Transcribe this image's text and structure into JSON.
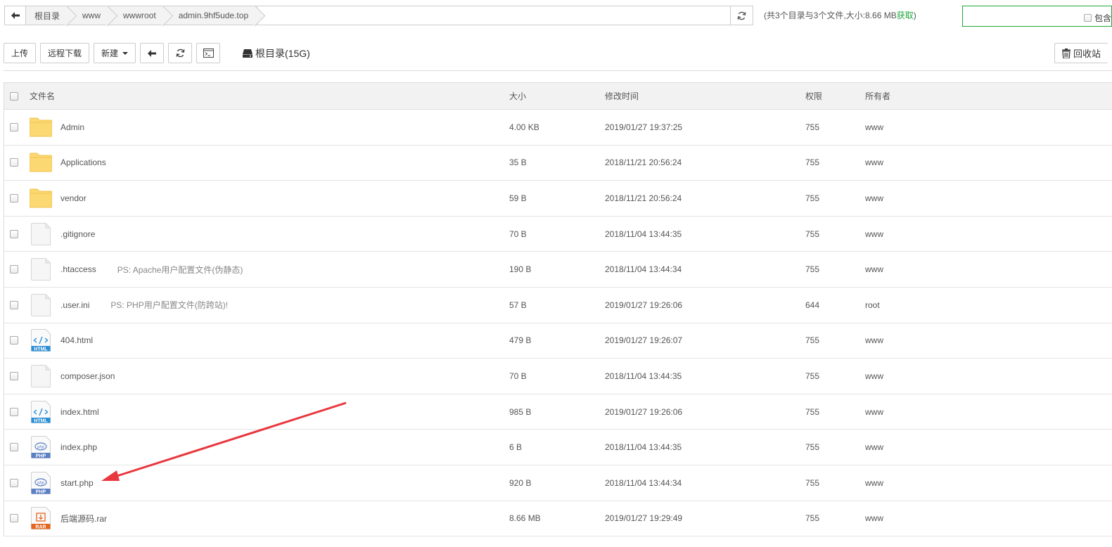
{
  "path": {
    "crumbs": [
      "根目录",
      "www",
      "wwwroot",
      "admin.9hf5ude.top"
    ]
  },
  "summary": {
    "text": "(共3个目录与3个文件,大小:8.66 MB",
    "link": "获取",
    "close": ")"
  },
  "search": {
    "include_label": "包含"
  },
  "toolbar": {
    "upload": "上传",
    "remote_download": "远程下载",
    "new": "新建",
    "disk_label": "根目录(15G)",
    "recycle": "回收站"
  },
  "table": {
    "headers": {
      "name": "文件名",
      "size": "大小",
      "time": "修改时间",
      "perm": "权限",
      "owner": "所有者"
    },
    "rows": [
      {
        "name": "Admin",
        "note": "",
        "icon": "folder-icon",
        "size": "4.00 KB",
        "time": "2019/01/27 19:37:25",
        "perm": "755",
        "owner": "www"
      },
      {
        "name": "Applications",
        "note": "",
        "icon": "folder-icon",
        "size": "35 B",
        "time": "2018/11/21 20:56:24",
        "perm": "755",
        "owner": "www"
      },
      {
        "name": "vendor",
        "note": "",
        "icon": "folder-icon",
        "size": "59 B",
        "time": "2018/11/21 20:56:24",
        "perm": "755",
        "owner": "www"
      },
      {
        "name": ".gitignore",
        "note": "",
        "icon": "file-icon",
        "size": "70 B",
        "time": "2018/11/04 13:44:35",
        "perm": "755",
        "owner": "www"
      },
      {
        "name": ".htaccess",
        "note": "PS: Apache用户配置文件(伪静态)",
        "icon": "file-icon",
        "size": "190 B",
        "time": "2018/11/04 13:44:34",
        "perm": "755",
        "owner": "www"
      },
      {
        "name": ".user.ini",
        "note": "PS: PHP用户配置文件(防跨站)!",
        "icon": "file-icon",
        "size": "57 B",
        "time": "2019/01/27 19:26:06",
        "perm": "644",
        "owner": "root"
      },
      {
        "name": "404.html",
        "note": "",
        "icon": "html-file-icon",
        "size": "479 B",
        "time": "2019/01/27 19:26:07",
        "perm": "755",
        "owner": "www"
      },
      {
        "name": "composer.json",
        "note": "",
        "icon": "file-icon",
        "size": "70 B",
        "time": "2018/11/04 13:44:35",
        "perm": "755",
        "owner": "www"
      },
      {
        "name": "index.html",
        "note": "",
        "icon": "html-file-icon",
        "size": "985 B",
        "time": "2019/01/27 19:26:06",
        "perm": "755",
        "owner": "www"
      },
      {
        "name": "index.php",
        "note": "",
        "icon": "php-file-icon",
        "size": "6 B",
        "time": "2018/11/04 13:44:35",
        "perm": "755",
        "owner": "www"
      },
      {
        "name": "start.php",
        "note": "",
        "icon": "php-file-icon",
        "size": "920 B",
        "time": "2018/11/04 13:44:34",
        "perm": "755",
        "owner": "www"
      },
      {
        "name": "后端源码.rar",
        "note": "",
        "icon": "rar-file-icon",
        "size": "8.66 MB",
        "time": "2019/01/27 19:29:49",
        "perm": "755",
        "owner": "www"
      }
    ]
  },
  "icon_badges": {
    "html": "HTML",
    "php_mark": "php",
    "php": "PHP",
    "rar": "RAR"
  },
  "colors": {
    "accent": "#20a53a",
    "annotation_arrow": "#e8373e",
    "folder": "#fcd873"
  }
}
